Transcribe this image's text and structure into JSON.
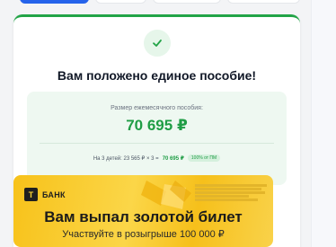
{
  "card": {
    "title": "Вам положено единое пособие!",
    "amount_label": "Размер ежемесячного пособия:",
    "amount_value": "70 695 ₽",
    "formula_text": "На 3 детей: 23 565 ₽ × 3 =",
    "formula_total": "70 695 ₽",
    "formula_badge": "100% от ПМ"
  },
  "banner": {
    "logo_text": "БАНК",
    "logo_letter": "Т",
    "title": "Вам выпал золотой билет",
    "subtitle": "Участвуйте в розыгрыше 100 000 ₽"
  },
  "colors": {
    "accent_green": "#1f9d45",
    "tab_blue": "#2563eb",
    "banner_yellow": "#f7c21a"
  },
  "icons": {
    "check": "check-icon"
  }
}
